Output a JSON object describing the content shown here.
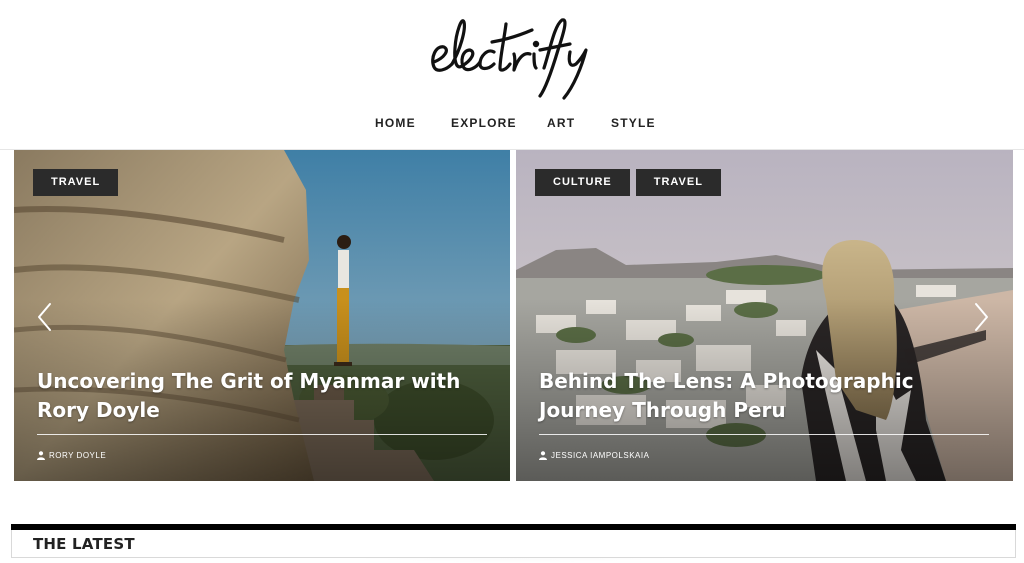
{
  "site": {
    "logo_text": "electrify"
  },
  "nav": {
    "items": [
      {
        "label": "HOME"
      },
      {
        "label": "EXPLORE"
      },
      {
        "label": "ART"
      },
      {
        "label": "STYLE"
      }
    ]
  },
  "slides": [
    {
      "tags": [
        "TRAVEL"
      ],
      "title": "Uncovering The Grit of Myanmar with Rory Doyle",
      "author": "RORY DOYLE"
    },
    {
      "tags": [
        "CULTURE",
        "TRAVEL"
      ],
      "title": "Behind The Lens: A Photographic Journey Through Peru",
      "author": "JESSICA IAMPOLSKAIA"
    }
  ],
  "latest": {
    "heading": "THE LATEST"
  },
  "icons": {
    "prev": "chevron-left-icon",
    "next": "chevron-right-icon",
    "author": "user-icon"
  }
}
